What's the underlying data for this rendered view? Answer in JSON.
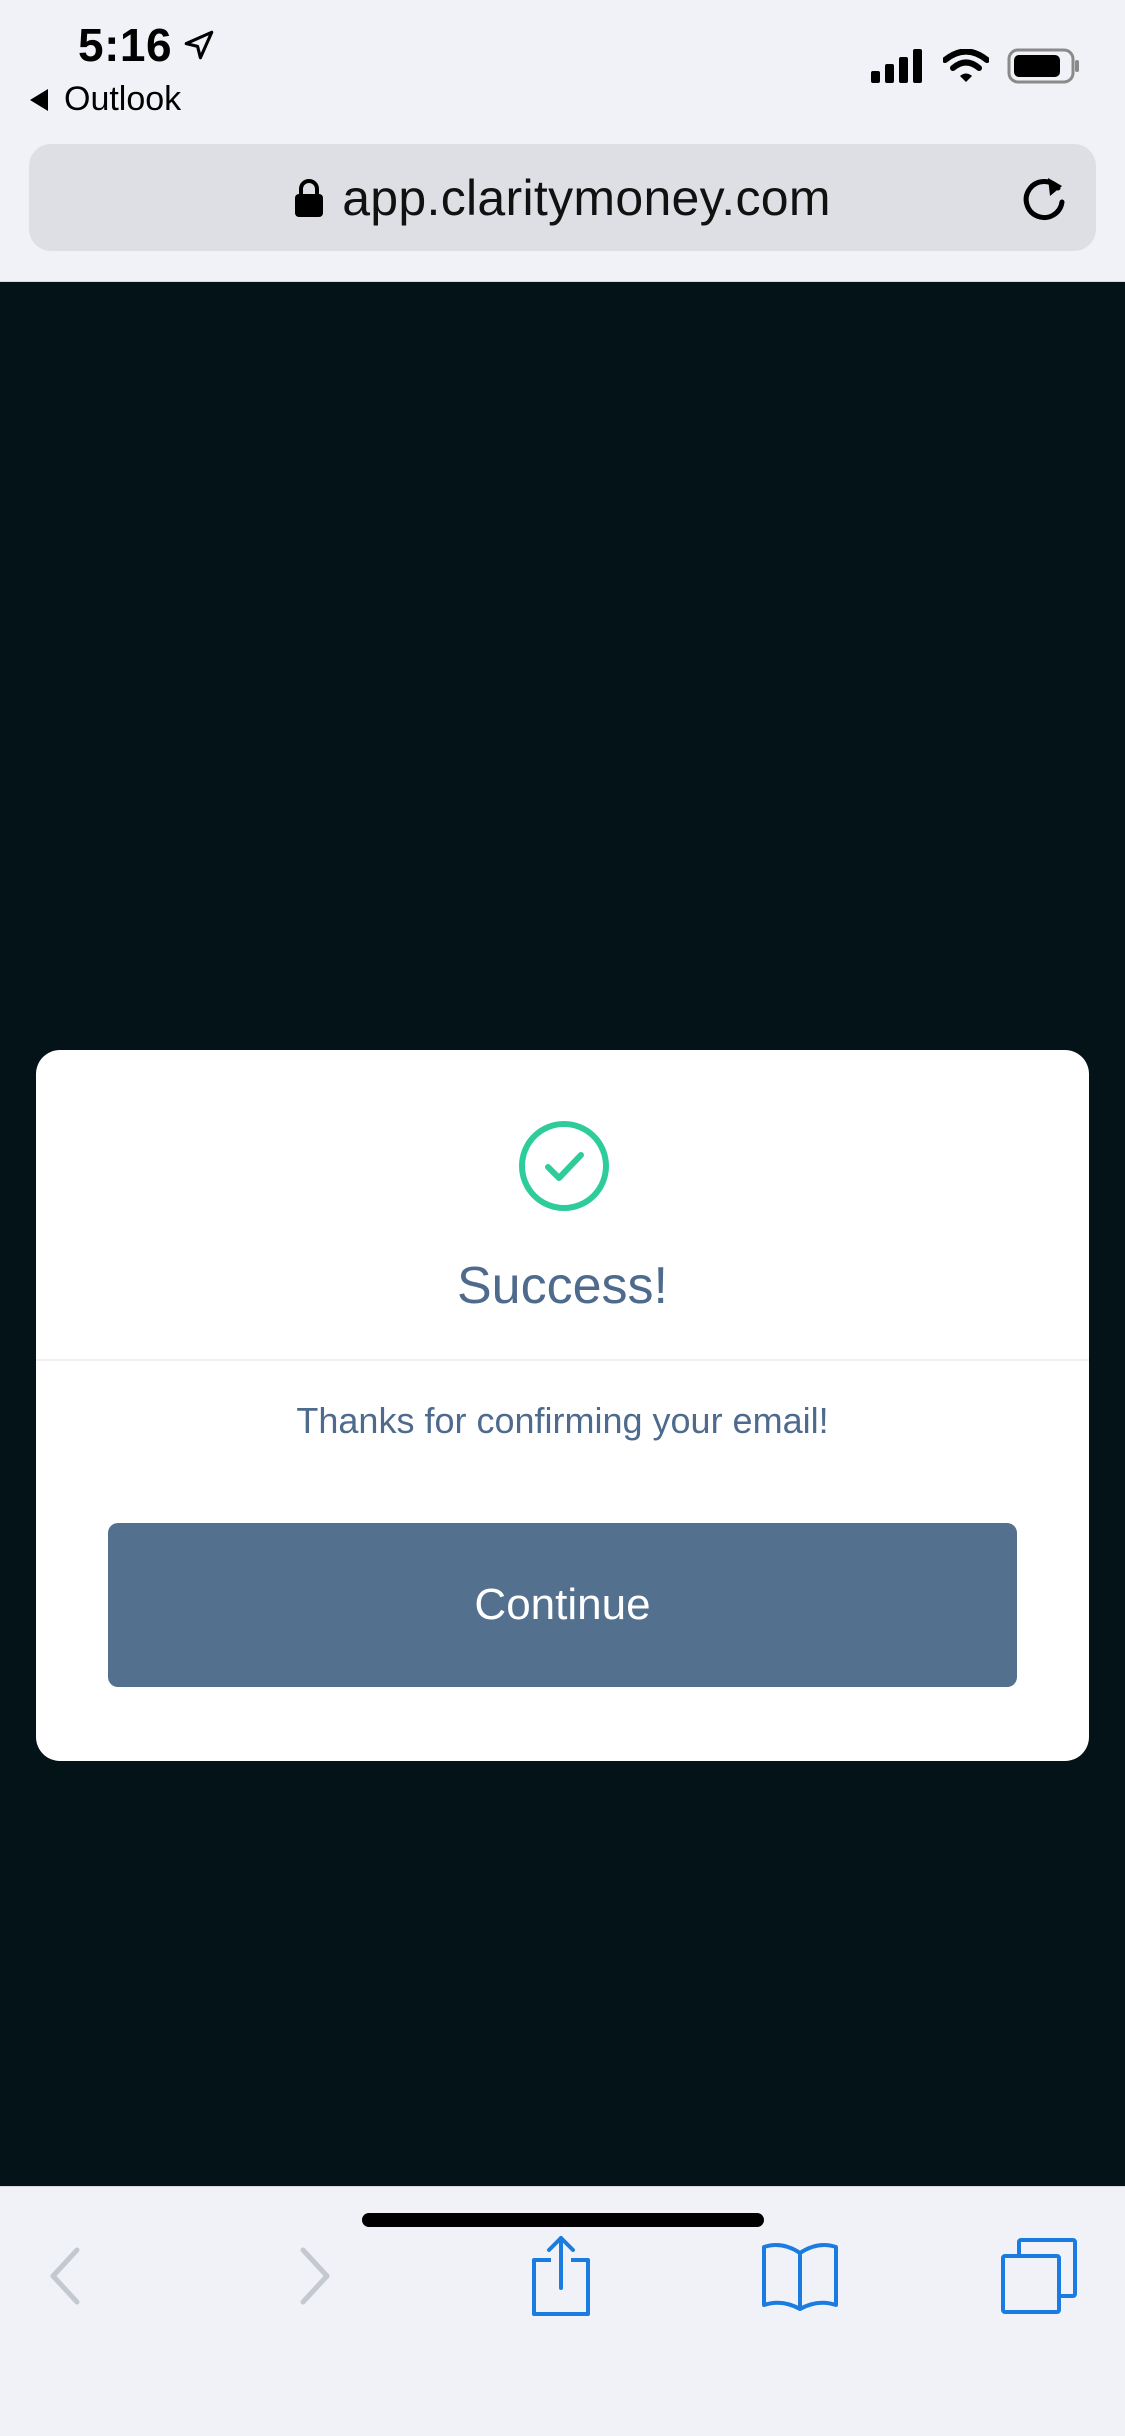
{
  "status_bar": {
    "time": "5:16",
    "back_app_label": "Outlook",
    "icons": [
      "location-arrow-icon",
      "cellular-signal-icon",
      "wifi-icon",
      "battery-icon"
    ]
  },
  "browser": {
    "url": "app.claritymoney.com",
    "secure_icon": "lock-icon",
    "reload_icon": "reload-icon"
  },
  "modal": {
    "icon": "check-circle-icon",
    "title": "Success!",
    "message": "Thanks for confirming your email!",
    "button_label": "Continue"
  },
  "toolbar": {
    "items": [
      "back-icon",
      "forward-icon",
      "share-icon",
      "bookmarks-icon",
      "tabs-icon"
    ]
  },
  "colors": {
    "page_background": "#031317",
    "chrome_background": "#f0f2f7",
    "url_bar": "#dddfe4",
    "accent_green": "#2ecc9a",
    "text_slate": "#4e6a8d",
    "button": "#53708f",
    "toolbar_blue": "#1a7ce0",
    "toolbar_disabled": "#c4c8cf"
  }
}
